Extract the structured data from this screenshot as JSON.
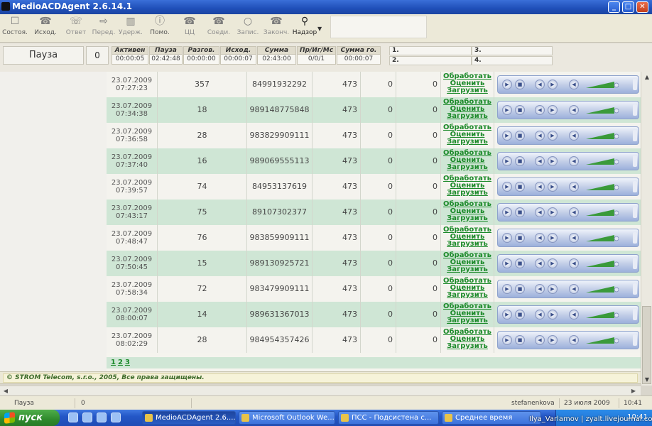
{
  "window": {
    "title": "MedioACDAgent 2.6.14.1",
    "minimize": "_",
    "maximize": "□",
    "close": "✕"
  },
  "toolbar": [
    {
      "label": "Состоя.",
      "icon": "☐"
    },
    {
      "label": "Исход.",
      "icon": "☎"
    },
    {
      "label": "Ответ",
      "icon": "☏"
    },
    {
      "label": "Перед.",
      "icon": "⇨"
    },
    {
      "label": "Удерж.",
      "icon": "▥"
    },
    {
      "label": "Помо.",
      "icon": "ⓘ"
    },
    {
      "label": "ЦЦ",
      "icon": "☎"
    },
    {
      "label": "Соеди.",
      "icon": "☎"
    },
    {
      "label": "Запис.",
      "icon": "○"
    },
    {
      "label": "Законч.",
      "icon": "☎"
    },
    {
      "label": "Надзор",
      "icon": "⚲"
    }
  ],
  "status": {
    "state": "Пауза",
    "count": "0",
    "columns": [
      {
        "header": "Активен",
        "value": "00:00:05"
      },
      {
        "header": "Пауза",
        "value": "02:42:48"
      },
      {
        "header": "Разгов.",
        "value": "00:00:00"
      },
      {
        "header": "Исход.",
        "value": "00:00:07"
      },
      {
        "header": "Сумма",
        "value": "02:43:00"
      },
      {
        "header": "Пр/Иг/Мс",
        "value": "0/0/1"
      },
      {
        "header": "Сумма го.",
        "value": "00:00:07"
      }
    ],
    "lines": [
      "1.",
      "2.",
      "3.",
      "4."
    ]
  },
  "links": {
    "process": "Обработать",
    "rate": "Оценить",
    "load": "Загрузить"
  },
  "rows": [
    {
      "date": "23.07.2009",
      "time": "07:27:23",
      "dur": "357",
      "phone": "84991932292",
      "code": "473",
      "z1": "0",
      "z2": "0"
    },
    {
      "date": "23.07.2009",
      "time": "07:34:38",
      "dur": "18",
      "phone": "989148775848",
      "code": "473",
      "z1": "0",
      "z2": "0"
    },
    {
      "date": "23.07.2009",
      "time": "07:36:58",
      "dur": "28",
      "phone": "983829909111",
      "code": "473",
      "z1": "0",
      "z2": "0"
    },
    {
      "date": "23.07.2009",
      "time": "07:37:40",
      "dur": "16",
      "phone": "989069555113",
      "code": "473",
      "z1": "0",
      "z2": "0"
    },
    {
      "date": "23.07.2009",
      "time": "07:39:57",
      "dur": "74",
      "phone": "84953137619",
      "code": "473",
      "z1": "0",
      "z2": "0"
    },
    {
      "date": "23.07.2009",
      "time": "07:43:17",
      "dur": "75",
      "phone": "89107302377",
      "code": "473",
      "z1": "0",
      "z2": "0"
    },
    {
      "date": "23.07.2009",
      "time": "07:48:47",
      "dur": "76",
      "phone": "983859909111",
      "code": "473",
      "z1": "0",
      "z2": "0"
    },
    {
      "date": "23.07.2009",
      "time": "07:50:45",
      "dur": "15",
      "phone": "989130925721",
      "code": "473",
      "z1": "0",
      "z2": "0"
    },
    {
      "date": "23.07.2009",
      "time": "07:58:34",
      "dur": "72",
      "phone": "983479909111",
      "code": "473",
      "z1": "0",
      "z2": "0"
    },
    {
      "date": "23.07.2009",
      "time": "08:00:07",
      "dur": "14",
      "phone": "989631367013",
      "code": "473",
      "z1": "0",
      "z2": "0"
    },
    {
      "date": "23.07.2009",
      "time": "08:02:29",
      "dur": "28",
      "phone": "984954357426",
      "code": "473",
      "z1": "0",
      "z2": "0"
    }
  ],
  "pages": [
    "1",
    "2",
    "3"
  ],
  "copyright": "© STROM Telecom, s.r.o., 2005, Все права защищены.",
  "statusbar": {
    "state": "Пауза",
    "count": "0",
    "user": "stefanenkova",
    "date": "23 июля 2009 г.",
    "time": "10:41"
  },
  "taskbar": {
    "start": "пуск",
    "tasks": [
      "MedioACDAgent 2.6....",
      "Microsoft Outlook We...",
      "ПСС - Подсистена с...",
      "Среднее время"
    ],
    "watermark": "Ilya_Varlamov | zyalt.livejournal.com",
    "clock": "10:41"
  }
}
